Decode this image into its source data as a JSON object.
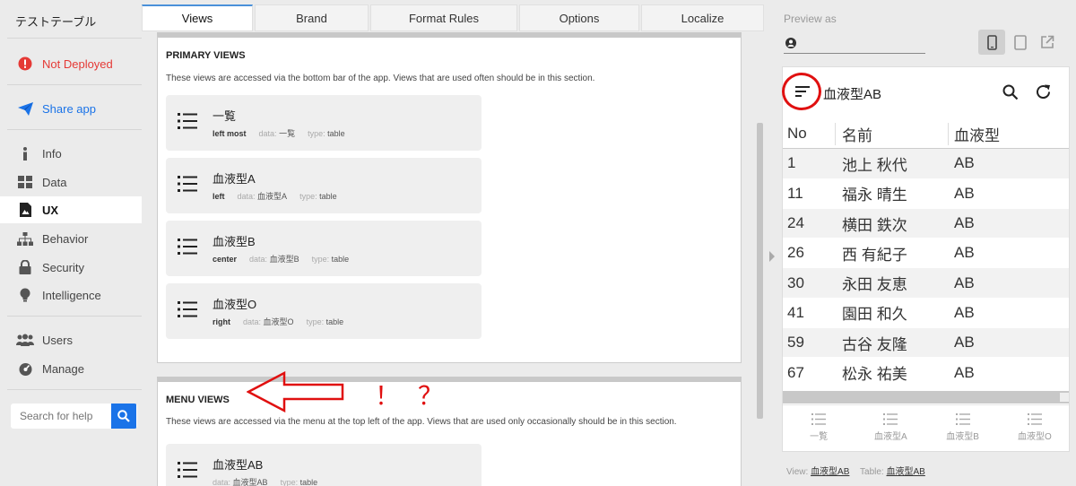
{
  "app_title": "テストテーブル",
  "sidebar": {
    "status": "Not Deployed",
    "share": "Share app",
    "items": [
      {
        "label": "Info",
        "icon": "info-icon"
      },
      {
        "label": "Data",
        "icon": "grid-icon"
      },
      {
        "label": "UX",
        "icon": "ux-icon",
        "active": true
      },
      {
        "label": "Behavior",
        "icon": "hierarchy-icon"
      },
      {
        "label": "Security",
        "icon": "lock-icon"
      },
      {
        "label": "Intelligence",
        "icon": "bulb-icon"
      },
      {
        "label": "Users",
        "icon": "users-icon"
      },
      {
        "label": "Manage",
        "icon": "gauge-icon"
      }
    ],
    "search_placeholder": "Search for help"
  },
  "tabs": [
    "Views",
    "Brand",
    "Format Rules",
    "Options",
    "Localize"
  ],
  "primary": {
    "title": "PRIMARY VIEWS",
    "desc": "These views are accessed via the bottom bar of the app. Views that are used often should be in this section.",
    "views": [
      {
        "name": "一覧",
        "position": "left most",
        "data": "一覧",
        "type": "table"
      },
      {
        "name": "血液型A",
        "position": "left",
        "data": "血液型A",
        "type": "table"
      },
      {
        "name": "血液型B",
        "position": "center",
        "data": "血液型B",
        "type": "table"
      },
      {
        "name": "血液型O",
        "position": "right",
        "data": "血液型O",
        "type": "table"
      }
    ]
  },
  "menu": {
    "title": "MENU VIEWS",
    "desc": "These views are accessed via the menu at the top left of the app. Views that are used only occasionally should be in this section.",
    "views": [
      {
        "name": "血液型AB",
        "position": "",
        "data": "血液型AB",
        "type": "table"
      }
    ]
  },
  "meta_labels": {
    "data": "data:",
    "type": "type:"
  },
  "annotation": {
    "text": "！？",
    "color": "#e01010"
  },
  "preview": {
    "label": "Preview as",
    "title": "血液型AB",
    "columns": [
      "No",
      "名前",
      "血液型"
    ],
    "rows": [
      [
        "1",
        "池上 秋代",
        "AB"
      ],
      [
        "11",
        "福永 晴生",
        "AB"
      ],
      [
        "24",
        "横田 鉄次",
        "AB"
      ],
      [
        "26",
        "西 有紀子",
        "AB"
      ],
      [
        "30",
        "永田 友恵",
        "AB"
      ],
      [
        "41",
        "園田 和久",
        "AB"
      ],
      [
        "59",
        "古谷 友隆",
        "AB"
      ],
      [
        "67",
        "松永 祐美",
        "AB"
      ]
    ],
    "nav": [
      "一覧",
      "血液型A",
      "血液型B",
      "血液型O"
    ],
    "footer": {
      "view_label": "View:",
      "view": "血液型AB",
      "table_label": "Table:",
      "table": "血液型AB"
    }
  },
  "colors": {
    "accent": "#1a73e8",
    "error": "#e53935",
    "annotation": "#e01010"
  }
}
